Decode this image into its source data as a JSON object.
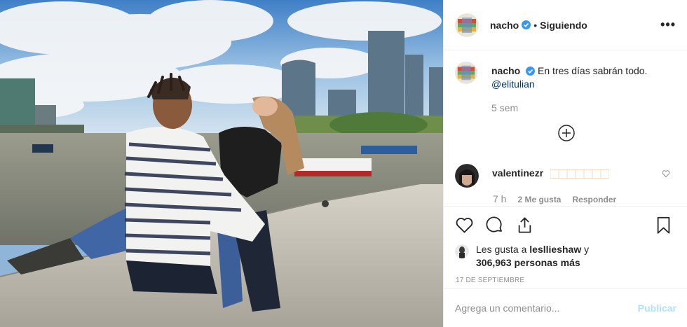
{
  "post": {
    "author": "nacho",
    "follow_status": "Siguiendo",
    "separator": "•",
    "more_label": "•••",
    "caption_text": "En tres días sabrán todo.",
    "caption_mention": "@elitulian",
    "age": "5 sem"
  },
  "comment": {
    "user": "valentinezr",
    "text": "🏻🏻🏻🏻🏻🏻🏻",
    "time": "7 h",
    "likes": "2 Me gusta",
    "reply": "Responder"
  },
  "actions": {
    "like_icon": "heart-icon",
    "comment_icon": "comment-icon",
    "share_icon": "share-icon",
    "save_icon": "bookmark-icon"
  },
  "likes": {
    "prefix": "Les gusta a",
    "user": "lesllieshaw",
    "and": "y",
    "count": "306,963 personas más"
  },
  "date": "17 de septiembre",
  "add_comment": {
    "placeholder": "Agrega un comentario...",
    "publish": "Publicar"
  },
  "colors": {
    "verified": "#3897f0",
    "link": "#003569",
    "muted": "#8e8e8e",
    "publish_disabled": "#b2dffc"
  }
}
